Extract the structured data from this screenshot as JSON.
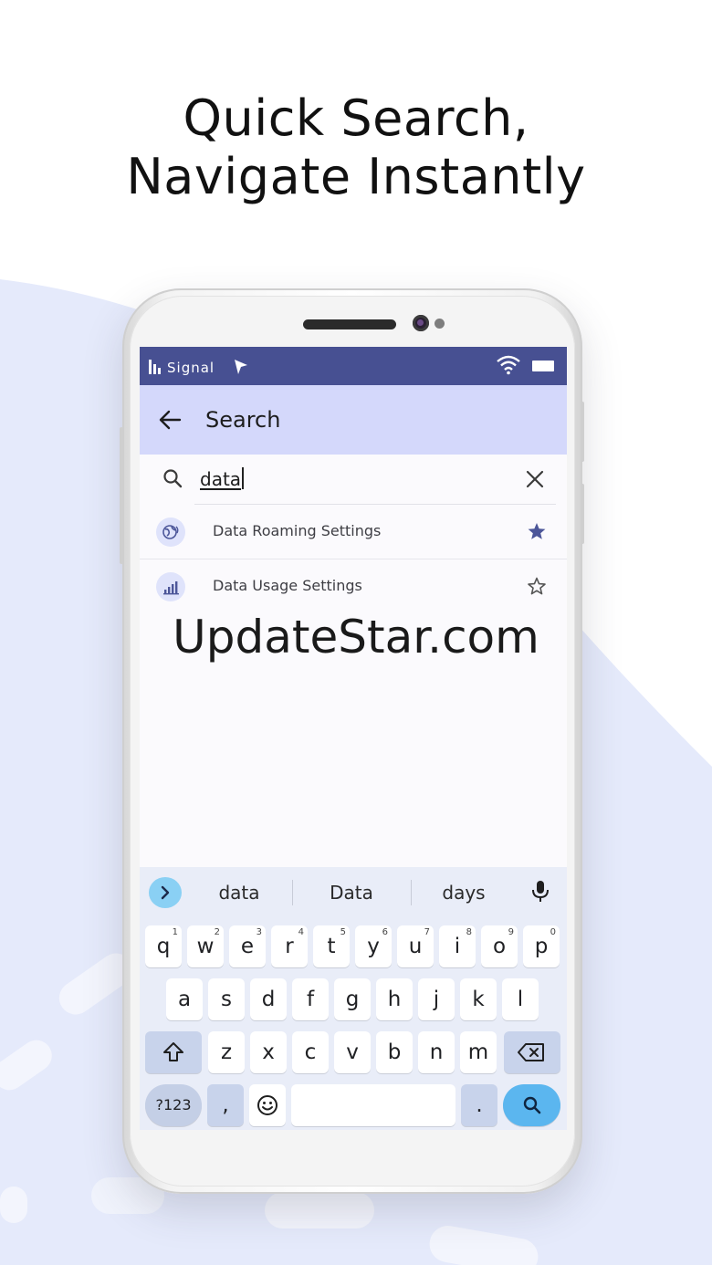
{
  "headline": {
    "line1": "Quick Search,",
    "line2": "Navigate Instantly"
  },
  "colors": {
    "status_bar": "#475092",
    "app_bar": "#d4d8fb",
    "accent": "#4c5699",
    "keyboard_bg": "#e9edf8",
    "search_key": "#5bb6ef",
    "background_wave": "#e5eafb"
  },
  "status_bar": {
    "signal_label": "Signal",
    "icons": [
      "signal-bars-icon",
      "cursor-arrow-icon",
      "wifi-icon",
      "battery-icon"
    ]
  },
  "app_bar": {
    "back_icon": "back-arrow-icon",
    "title": "Search"
  },
  "search": {
    "value": "data",
    "icon": "search-icon",
    "clear_icon": "close-icon"
  },
  "results": [
    {
      "label": "Data Roaming Settings",
      "icon": "globe-roaming-icon",
      "favorite": true
    },
    {
      "label": "Data Usage Settings",
      "icon": "signal-chart-icon",
      "favorite": false
    }
  ],
  "watermark": "UpdateStar.com",
  "keyboard": {
    "suggestions": [
      "data",
      "Data",
      "days"
    ],
    "row1": [
      {
        "k": "q",
        "h": "1"
      },
      {
        "k": "w",
        "h": "2"
      },
      {
        "k": "e",
        "h": "3"
      },
      {
        "k": "r",
        "h": "4"
      },
      {
        "k": "t",
        "h": "5"
      },
      {
        "k": "y",
        "h": "6"
      },
      {
        "k": "u",
        "h": "7"
      },
      {
        "k": "i",
        "h": "8"
      },
      {
        "k": "o",
        "h": "9"
      },
      {
        "k": "p",
        "h": "0"
      }
    ],
    "row2": [
      "a",
      "s",
      "d",
      "f",
      "g",
      "h",
      "j",
      "k",
      "l"
    ],
    "row3": [
      "z",
      "x",
      "c",
      "v",
      "b",
      "n",
      "m"
    ],
    "symbols_label": "?123",
    "comma_label": ",",
    "period_label": "."
  }
}
